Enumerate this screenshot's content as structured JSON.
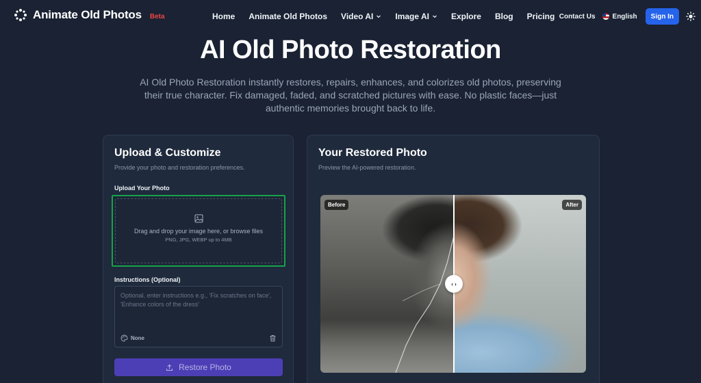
{
  "nav": {
    "brand_name": "Animate Old Photos",
    "brand_badge": "Beta",
    "links": [
      {
        "label": "Home",
        "dropdown": false
      },
      {
        "label": "Animate Old Photos",
        "dropdown": false
      },
      {
        "label": "Video AI",
        "dropdown": true
      },
      {
        "label": "Image AI",
        "dropdown": true
      },
      {
        "label": "Explore",
        "dropdown": false
      },
      {
        "label": "Blog",
        "dropdown": false
      },
      {
        "label": "Pricing",
        "dropdown": false
      }
    ],
    "contact": "Contact Us",
    "language": "English",
    "sign_in": "Sign In",
    "theme_icon": "sun-icon"
  },
  "hero": {
    "title": "AI Old Photo Restoration",
    "description": "AI Old Photo Restoration instantly restores, repairs, enhances, and colorizes old photos, preserving their true character. Fix damaged, faded, and scratched pictures with ease. No plastic faces—just authentic memories brought back to life."
  },
  "upload_card": {
    "title": "Upload & Customize",
    "subtitle": "Provide your photo and restoration preferences.",
    "upload_label": "Upload Your Photo",
    "dropzone_text": "Drag and drop your image here, or browse files",
    "dropzone_hint": "PNG, JPG, WEBP up to 4MB",
    "instructions_label": "Instructions (Optional)",
    "instructions_placeholder": "Optional, enter instructions e.g., 'Fix scratches on face', 'Enhance colors of the dress'",
    "style_value": "None",
    "restore_button": "Restore Photo"
  },
  "result_card": {
    "title": "Your Restored Photo",
    "subtitle": "Preview the AI-powered restoration.",
    "before_label": "Before",
    "after_label": "After",
    "handle_label": "‹ ›"
  },
  "colors": {
    "background": "#1a2233",
    "accent_blue": "#2563eb",
    "accent_purple": "#4c3fb5",
    "highlight_green": "#16a34a",
    "beta_red": "#ef4444"
  }
}
